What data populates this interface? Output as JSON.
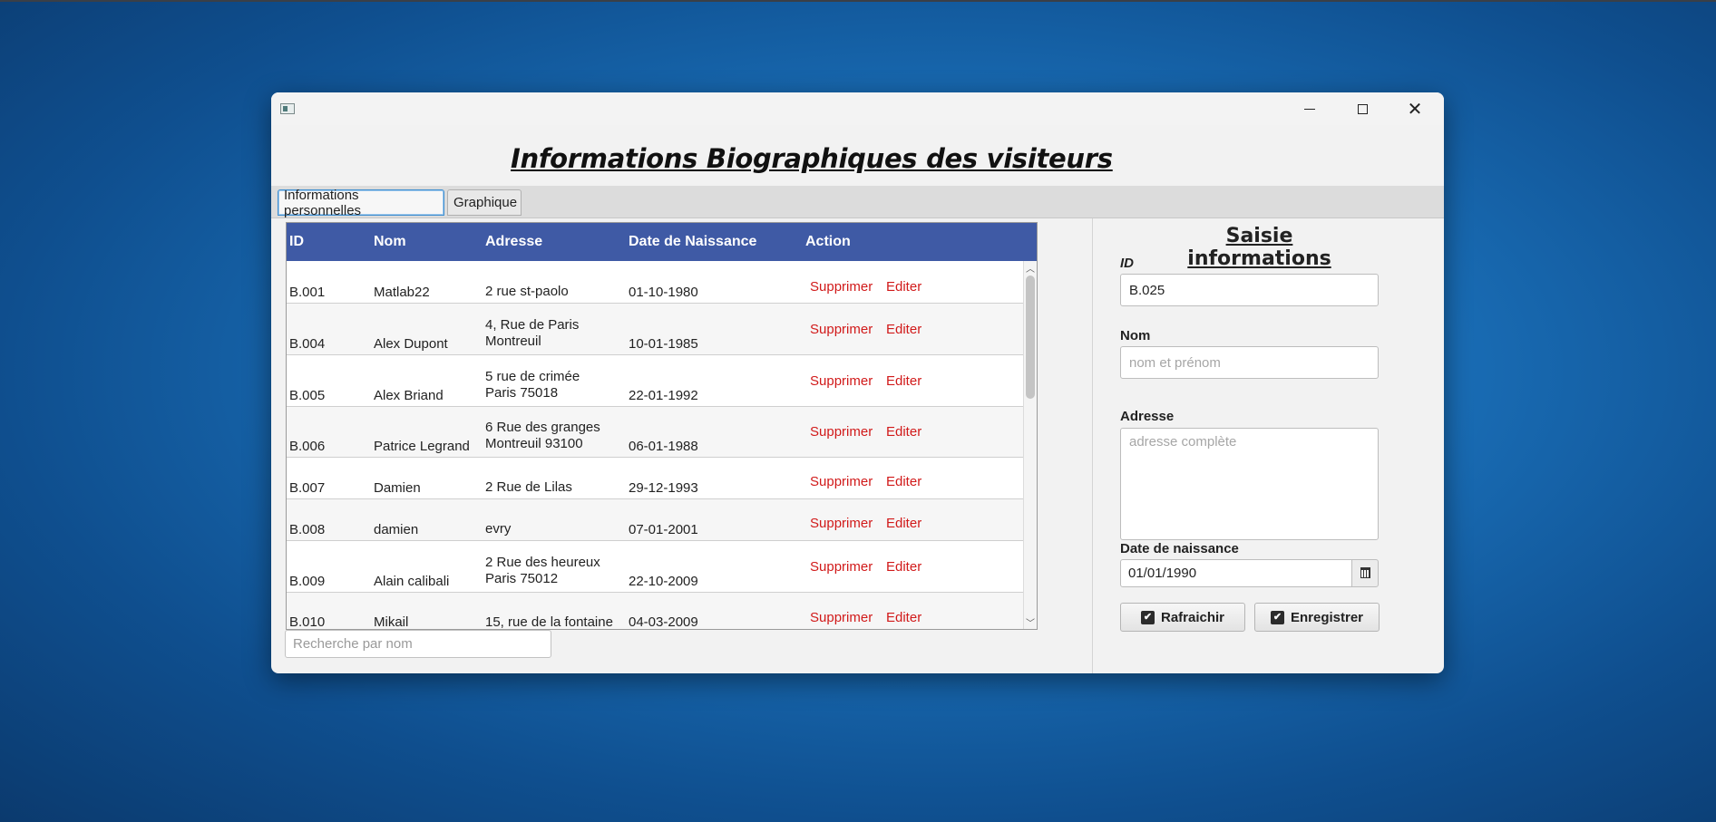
{
  "window": {
    "title": "Informations Biographiques des visiteurs"
  },
  "tabs": [
    {
      "label": "Informations personnelles",
      "active": true
    },
    {
      "label": "Graphique",
      "active": false
    }
  ],
  "table": {
    "columns": [
      "ID",
      "Nom",
      "Adresse",
      "Date de Naissance",
      "Action"
    ],
    "rows": [
      {
        "id": "B.001",
        "nom": "Matlab22",
        "adresse": "2 rue st-paolo",
        "date": "01-10-1980"
      },
      {
        "id": "B.004",
        "nom": "Alex Dupont",
        "adresse": "4, Rue de Paris\nMontreuil",
        "date": "10-01-1985"
      },
      {
        "id": "B.005",
        "nom": "Alex Briand",
        "adresse": "5 rue de crimée\nParis 75018",
        "date": "22-01-1992"
      },
      {
        "id": "B.006",
        "nom": "Patrice Legrand",
        "adresse": "6 Rue des granges\nMontreuil 93100",
        "date": "06-01-1988"
      },
      {
        "id": "B.007",
        "nom": "Damien",
        "adresse": "2 Rue de Lilas",
        "date": "29-12-1993"
      },
      {
        "id": "B.008",
        "nom": "damien",
        "adresse": "evry",
        "date": "07-01-2001"
      },
      {
        "id": "B.009",
        "nom": "Alain calibali",
        "adresse": "2 Rue des heureux\nParis 75012",
        "date": "22-10-2009"
      },
      {
        "id": "B.010",
        "nom": "Mikail",
        "adresse": "15, rue de la fontaine",
        "date": "04-03-2009"
      }
    ],
    "actions": {
      "delete": "Supprimer",
      "edit": "Editer"
    },
    "action_color": "#d11a1a",
    "header_color": "#3f5aa5"
  },
  "search": {
    "placeholder": "Recherche par nom",
    "value": ""
  },
  "form": {
    "title": "Saisie informations",
    "id_label": "ID",
    "id_value": "B.025",
    "nom_label": "Nom",
    "nom_placeholder": "nom et prénom",
    "adresse_label": "Adresse",
    "adresse_placeholder": "adresse complète",
    "date_label": "Date de naissance",
    "date_value": "01/01/1990",
    "refresh_label": "Rafraichir",
    "save_label": "Enregistrer"
  },
  "icons": {
    "app": "app-icon",
    "minimize": "minimize-icon",
    "maximize": "maximize-icon",
    "close": "close-icon",
    "calendar": "calendar-icon",
    "checkbox": "checkbox-checked-icon"
  }
}
